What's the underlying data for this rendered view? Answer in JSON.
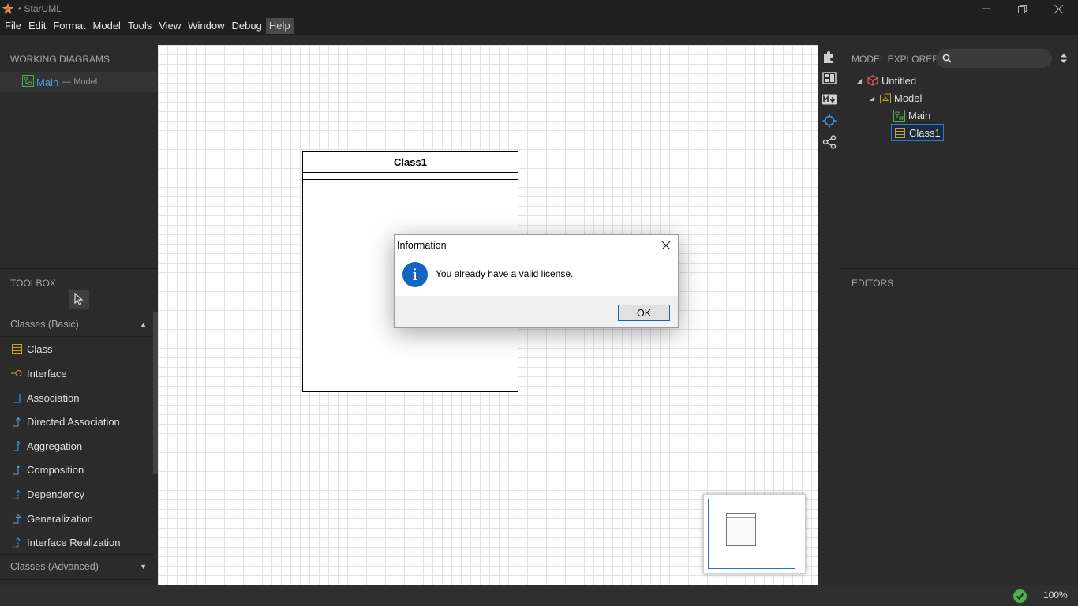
{
  "window": {
    "title": "• StarUML",
    "minimize_icon": "minimize-icon",
    "maximize_icon": "restore-icon",
    "close_icon": "close-icon"
  },
  "menubar": {
    "items": [
      "File",
      "Edit",
      "Format",
      "Model",
      "Tools",
      "View",
      "Window",
      "Debug",
      "Help"
    ],
    "active": "Help"
  },
  "working_diagrams": {
    "title": "WORKING DIAGRAMS",
    "item": {
      "label": "Main",
      "sub": "— Model",
      "icon": "class-diagram-icon"
    }
  },
  "toolbox": {
    "title": "TOOLBOX",
    "pointer_icon": "pointer-icon",
    "groups": [
      {
        "label": "Classes (Basic)",
        "expanded": true
      },
      {
        "label": "Classes (Advanced)",
        "expanded": false
      }
    ],
    "items": [
      {
        "label": "Class",
        "icon": "class-icon"
      },
      {
        "label": "Interface",
        "icon": "interface-icon"
      },
      {
        "label": "Association",
        "icon": "association-icon"
      },
      {
        "label": "Directed Association",
        "icon": "directed-association-icon"
      },
      {
        "label": "Aggregation",
        "icon": "aggregation-icon"
      },
      {
        "label": "Composition",
        "icon": "composition-icon"
      },
      {
        "label": "Dependency",
        "icon": "dependency-icon"
      },
      {
        "label": "Generalization",
        "icon": "generalization-icon"
      },
      {
        "label": "Interface Realization",
        "icon": "interface-realization-icon"
      }
    ]
  },
  "diagram": {
    "class_name": "Class1"
  },
  "side_tools": [
    "extensions-icon",
    "layout-icon",
    "markdown-icon",
    "navigate-icon",
    "share-icon"
  ],
  "model_explorer": {
    "title": "MODEL EXPLORER",
    "search_placeholder": "",
    "tree": [
      {
        "label": "Untitled",
        "icon": "project-icon",
        "level": 0,
        "expanded": true
      },
      {
        "label": "Model",
        "icon": "model-icon",
        "level": 1,
        "expanded": true
      },
      {
        "label": "Main",
        "icon": "class-diagram-icon",
        "level": 2
      },
      {
        "label": "Class1",
        "icon": "class-icon",
        "level": 2,
        "selected": true
      }
    ]
  },
  "editors": {
    "title": "EDITORS"
  },
  "statusbar": {
    "zoom": "100%",
    "status_icon": "check-icon"
  },
  "dialog": {
    "title": "Information",
    "message": "You already have a valid license.",
    "ok_label": "OK",
    "icon": "info-icon"
  },
  "colors": {
    "accent": "#2a7bd4",
    "diagram_link": "#4d9fe8",
    "model_icon": "#c8a02a",
    "project_icon": "#e05555",
    "status_ok": "#4caf50"
  }
}
